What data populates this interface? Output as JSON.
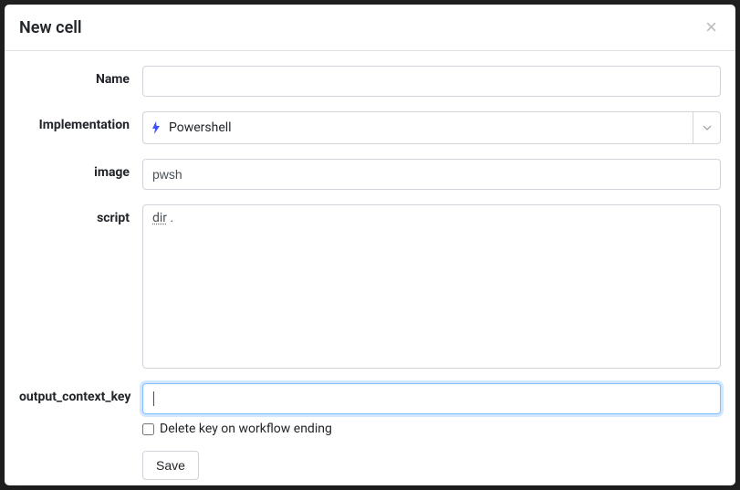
{
  "modal": {
    "title": "New cell"
  },
  "form": {
    "name": {
      "label": "Name",
      "value": ""
    },
    "implementation": {
      "label": "Implementation",
      "value": "Powershell"
    },
    "image": {
      "label": "image",
      "value": "pwsh"
    },
    "script": {
      "label": "script",
      "value_word": "dir",
      "value_rest": " ."
    },
    "output_context_key": {
      "label": "output_context_key",
      "value": ""
    },
    "delete_key": {
      "label": "Delete key on workflow ending",
      "checked": false
    },
    "save_label": "Save"
  }
}
